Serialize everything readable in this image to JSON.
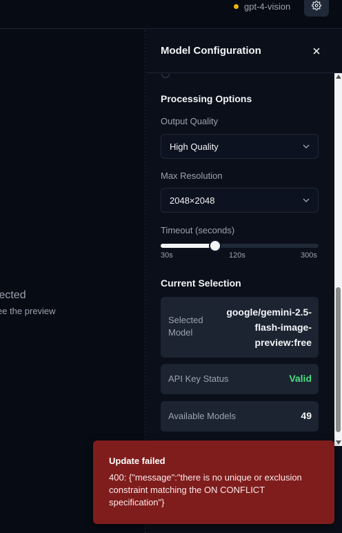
{
  "header": {
    "model_name": "gpt-4-vision",
    "status_color": "#eab308",
    "settings_icon": "gear-icon"
  },
  "empty_state": {
    "title": "elected",
    "subtitle": "ee the preview"
  },
  "panel": {
    "title": "Model Configuration",
    "close_icon": "close-icon",
    "processing": {
      "title": "Processing Options",
      "output_quality_label": "Output Quality",
      "output_quality_value": "High Quality",
      "max_resolution_label": "Max Resolution",
      "max_resolution_value": "2048×2048",
      "timeout_label": "Timeout (seconds)",
      "timeout_min": "30s",
      "timeout_mid": "120s",
      "timeout_max": "300s",
      "timeout_value": 120
    },
    "current_selection": {
      "title": "Current Selection",
      "selected_model_label": "Selected Model",
      "selected_model_value": "google/gemini-2.5-flash-image-preview:free",
      "api_key_label": "API Key Status",
      "api_key_value": "Valid",
      "available_models_label": "Available Models",
      "available_models_value": "49"
    }
  },
  "toast": {
    "title": "Update failed",
    "message": "400: {\"message\":\"there is no unique or exclusion constraint matching the ON CONFLICT specification\"}",
    "color": "#7f1d1d"
  }
}
